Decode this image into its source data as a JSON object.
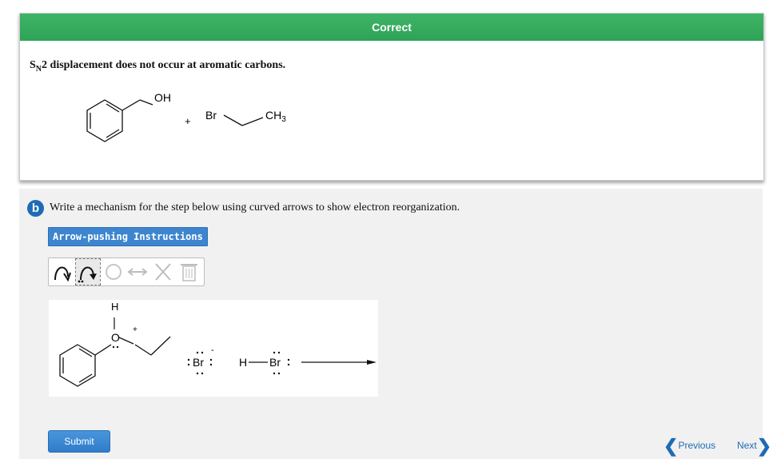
{
  "feedback": {
    "status": "Correct",
    "message_prefix": "S",
    "message_sub": "N",
    "message_rest": "2 displacement does not occur at aromatic carbons.",
    "figure": {
      "oh": "OH",
      "plus": "+",
      "br": "Br",
      "ch3": "CH3"
    },
    "header_color": "#34aa5c"
  },
  "part": {
    "badge": "b",
    "prompt": "Write a mechanism for the step below using curved arrows to show electron reorganization.",
    "instructions_button": "Arrow-pushing Instructions",
    "toolbar": {
      "tools": [
        "curved-arrow-single-electron-icon",
        "curved-arrow-pair-icon",
        "circle-icon",
        "resonance-arrow-icon",
        "delete-x-icon",
        "trash-icon"
      ]
    },
    "canvas": {
      "h": "H",
      "o": "O",
      "plus": "+",
      "br_anion": "Br",
      "minus": "-",
      "hbr_h": "H",
      "hbr_br": "Br"
    }
  },
  "submit_label": "Submit",
  "nav": {
    "previous": "Previous",
    "next": "Next"
  },
  "colors": {
    "accent": "#1f6bb5",
    "success": "#34aa5c"
  }
}
